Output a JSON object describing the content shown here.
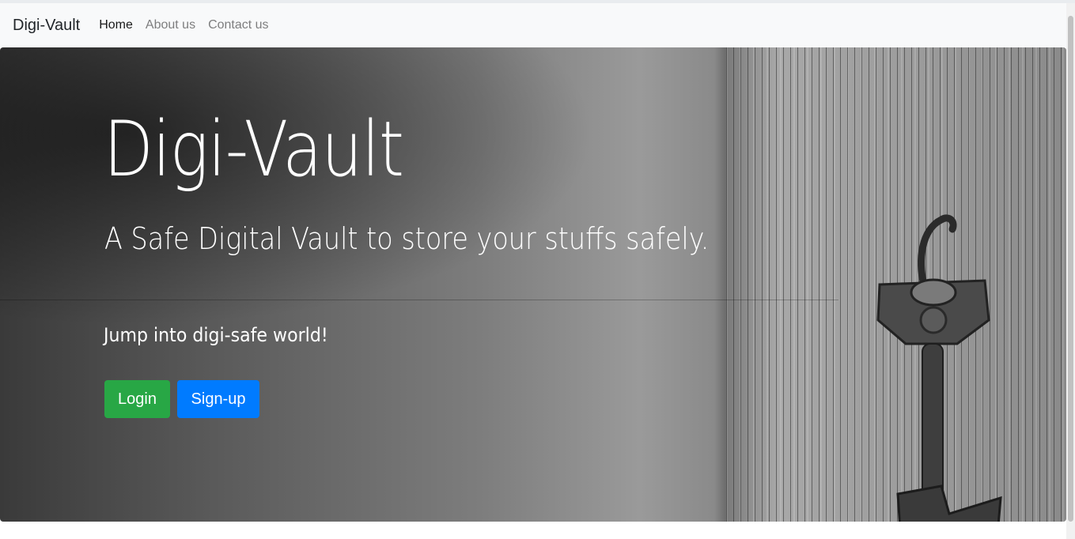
{
  "navbar": {
    "brand": "Digi-Vault",
    "links": [
      {
        "label": "Home",
        "active": true
      },
      {
        "label": "About us",
        "active": false
      },
      {
        "label": "Contact us",
        "active": false
      }
    ]
  },
  "hero": {
    "title": "Digi-Vault",
    "lead": "A Safe Digital Vault to store your stuffs safely.",
    "tagline": "Jump into digi-safe world!",
    "login_label": "Login",
    "signup_label": "Sign-up",
    "login_color": "#28a745",
    "signup_color": "#007bff"
  }
}
